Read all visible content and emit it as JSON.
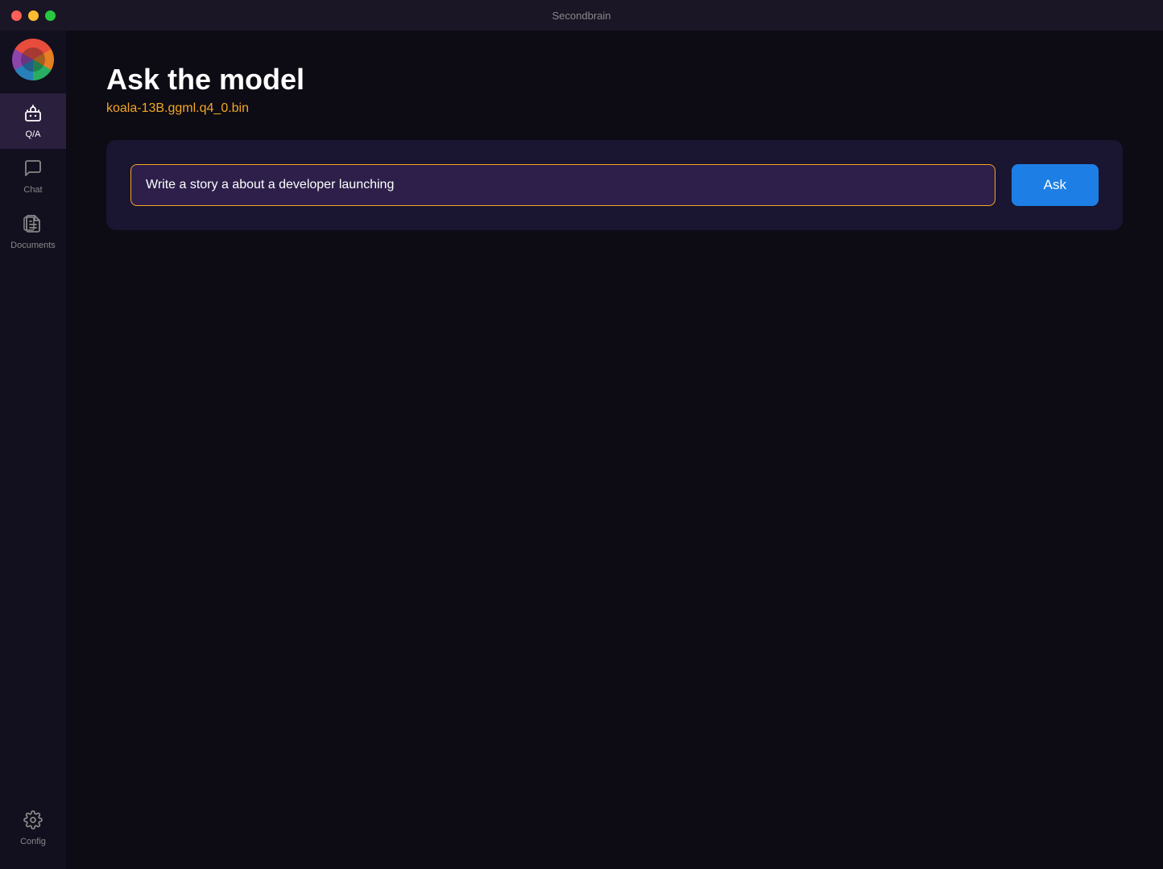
{
  "titlebar": {
    "title": "Secondbrain"
  },
  "sidebar": {
    "logo_alt": "Secondbrain Logo",
    "nav_items": [
      {
        "id": "qa",
        "label": "Q/A",
        "icon": "robot",
        "active": true
      },
      {
        "id": "chat",
        "label": "Chat",
        "icon": "chat",
        "active": false
      },
      {
        "id": "documents",
        "label": "Documents",
        "icon": "documents",
        "active": false
      }
    ],
    "bottom_items": [
      {
        "id": "config",
        "label": "Config",
        "icon": "gear"
      }
    ]
  },
  "main": {
    "page_title": "Ask the model",
    "model_name": "koala-13B.ggml.q4_0.bin",
    "query_input_value": "Write a story a about a developer launching",
    "query_input_placeholder": "Write a story a about a developer launching",
    "ask_button_label": "Ask"
  }
}
